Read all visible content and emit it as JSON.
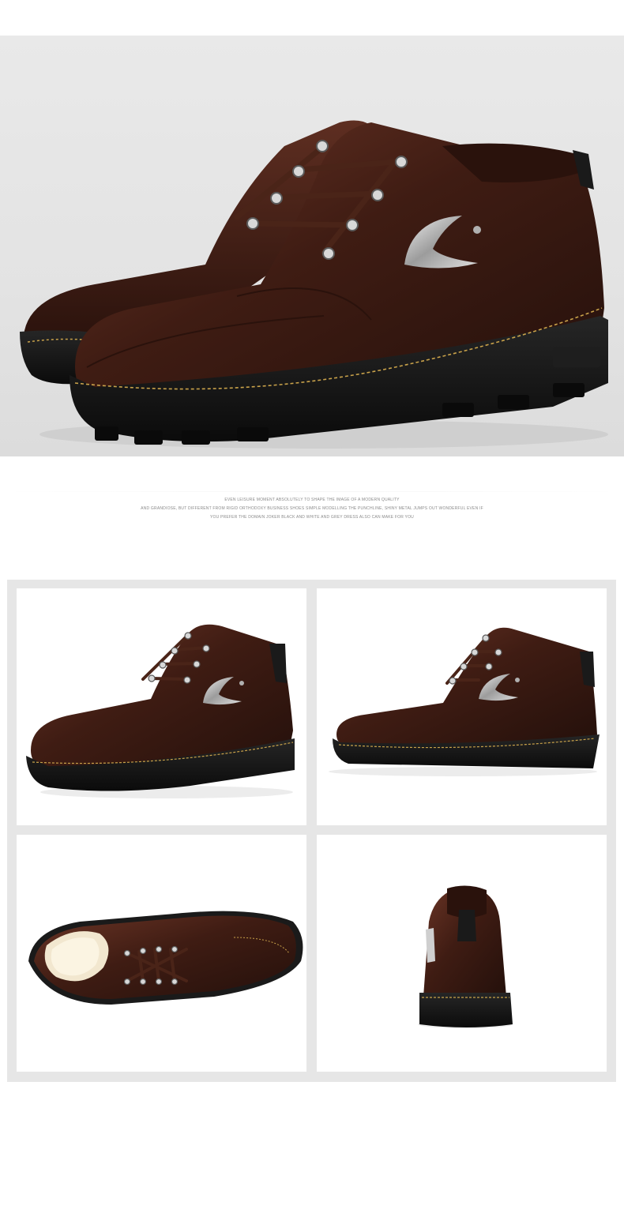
{
  "tagline": {
    "line1": "EVEN LEISURE MOMENT ABSOLUTELY TO SHAPE THE IMAGE OF A MODERN QUALITY",
    "line2": "AND GRANDIOSE, BUT DIFFERENT FROM RIGID ORTHODOXY BUSINESS SHOES SIMPLE MODELLING THE PUNCHLINE, SHINY METAL JUMPS OUT WONDERFUL EVEN IF",
    "line3": "YOU PREFER THE DOMAIN JOKER BLACK AND WHITE AND GREY DRESS ALSO CAN MAKE FOR YOU"
  },
  "colors": {
    "leather": "#3a1a12",
    "leather_highlight": "#7a4030",
    "sole": "#141414",
    "stitch": "#c9a24a",
    "metal": "#c8c8c8",
    "hero_bg": "#e4e4e4",
    "gallery_bg": "#e6e6e6"
  },
  "images": {
    "hero": "brown-leather-boots-pair",
    "tile1": "boot-side-angle",
    "tile2": "boot-side-profile",
    "tile3": "boot-top-down-with-wool-lining",
    "tile4": "boot-rear-view"
  }
}
